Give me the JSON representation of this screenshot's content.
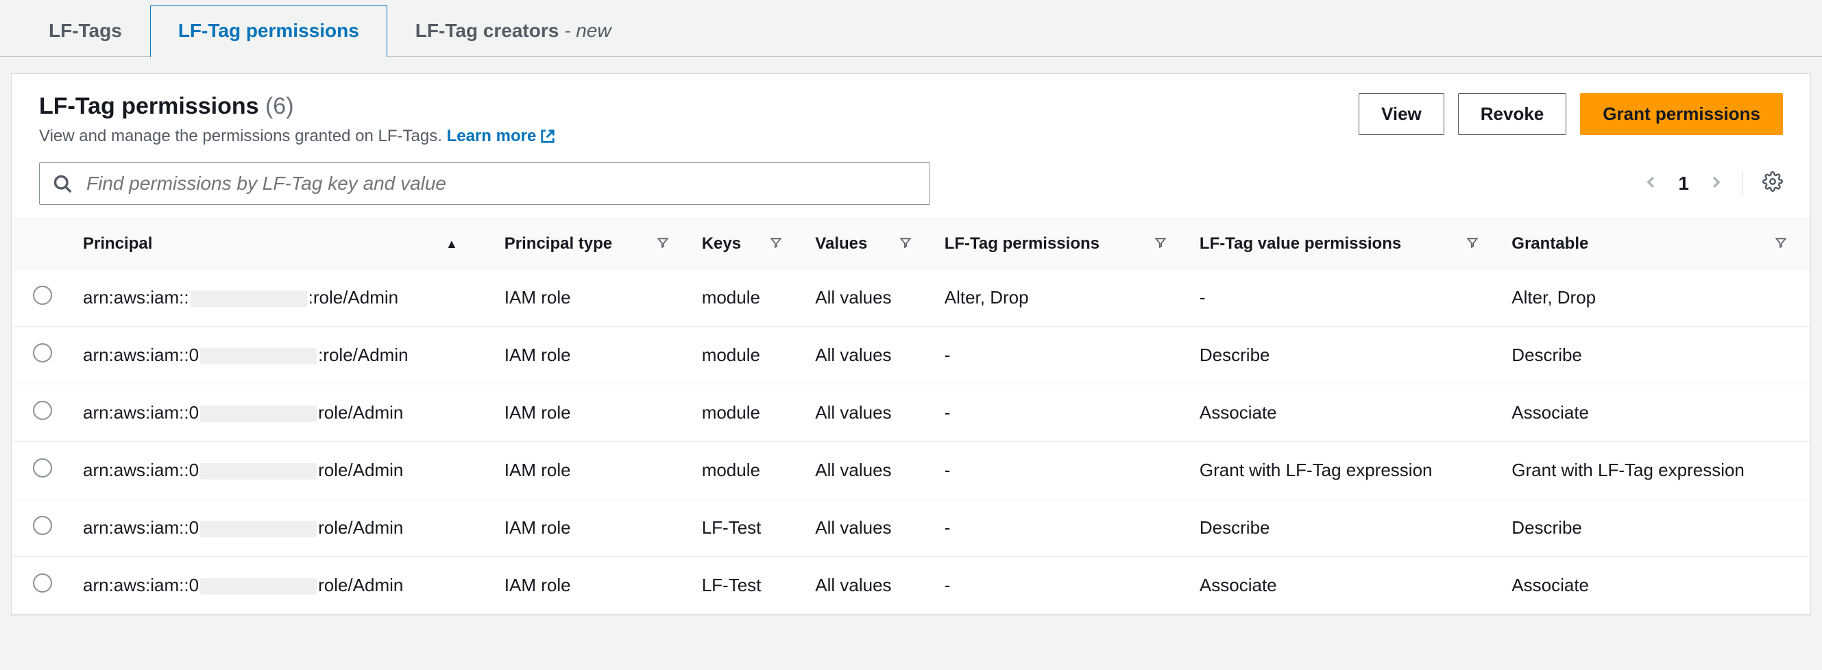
{
  "tabs": [
    {
      "label": "LF-Tags",
      "active": false,
      "new": false
    },
    {
      "label": "LF-Tag permissions",
      "active": true,
      "new": false
    },
    {
      "label": "LF-Tag creators",
      "active": false,
      "new": true,
      "suffix": " - new"
    }
  ],
  "header": {
    "title": "LF-Tag permissions",
    "count": "(6)",
    "subtitle": "View and manage the permissions granted on LF-Tags.",
    "learn_more": "Learn more"
  },
  "actions": {
    "view": "View",
    "revoke": "Revoke",
    "grant": "Grant permissions"
  },
  "search": {
    "placeholder": "Find permissions by LF-Tag key and value"
  },
  "pager": {
    "page": "1"
  },
  "columns": {
    "principal": "Principal",
    "principal_type": "Principal type",
    "keys": "Keys",
    "values": "Values",
    "lf_tag_permissions": "LF-Tag permissions",
    "lf_tag_value_permissions": "LF-Tag value permissions",
    "grantable": "Grantable"
  },
  "rows": [
    {
      "principal_pre": "arn:aws:iam::",
      "principal_post": ":role/Admin",
      "principal_type": "IAM role",
      "keys": "module",
      "values": "All values",
      "lf_tag_permissions": "Alter, Drop",
      "lf_tag_value_permissions": "-",
      "grantable": "Alter, Drop"
    },
    {
      "principal_pre": "arn:aws:iam::0",
      "principal_post": ":role/Admin",
      "principal_type": "IAM role",
      "keys": "module",
      "values": "All values",
      "lf_tag_permissions": "-",
      "lf_tag_value_permissions": "Describe",
      "grantable": "Describe"
    },
    {
      "principal_pre": "arn:aws:iam::0",
      "principal_post": "role/Admin",
      "principal_type": "IAM role",
      "keys": "module",
      "values": "All values",
      "lf_tag_permissions": "-",
      "lf_tag_value_permissions": "Associate",
      "grantable": "Associate"
    },
    {
      "principal_pre": "arn:aws:iam::0",
      "principal_post": "role/Admin",
      "principal_type": "IAM role",
      "keys": "module",
      "values": "All values",
      "lf_tag_permissions": "-",
      "lf_tag_value_permissions": "Grant with LF-Tag expression",
      "grantable": "Grant with LF-Tag expression"
    },
    {
      "principal_pre": "arn:aws:iam::0",
      "principal_post": "role/Admin",
      "principal_type": "IAM role",
      "keys": "LF-Test",
      "values": "All values",
      "lf_tag_permissions": "-",
      "lf_tag_value_permissions": "Describe",
      "grantable": "Describe"
    },
    {
      "principal_pre": "arn:aws:iam::0",
      "principal_post": "role/Admin",
      "principal_type": "IAM role",
      "keys": "LF-Test",
      "values": "All values",
      "lf_tag_permissions": "-",
      "lf_tag_value_permissions": "Associate",
      "grantable": "Associate"
    }
  ]
}
